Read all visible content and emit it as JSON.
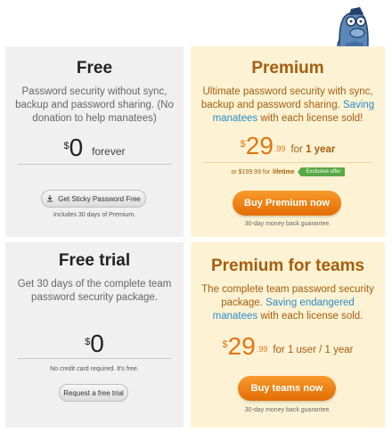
{
  "free": {
    "title": "Free",
    "description": "Password security without sync, backup and password sharing. (No donation to help manatees)",
    "currency": "$",
    "price": "0",
    "period": "forever",
    "button_label": "Get Sticky Password Free",
    "note": "Includes 30 days of Premium."
  },
  "premium": {
    "title": "Premium",
    "description_part1": "Ultimate password security with sync, backup and password sharing. ",
    "description_link": "Saving manatees",
    "description_part2": " with each license sold!",
    "currency": "$",
    "price": "29",
    "cents": ".99",
    "period_prefix": "for ",
    "period_bold": "1 year",
    "alt_price": "or $199.99 for",
    "alt_bold": "lifetime",
    "badge": "Exclusive offer",
    "button_label": "Buy Premium now",
    "note": "30-day money back guarantee."
  },
  "trial": {
    "title": "Free trial",
    "description": "Get 30 days of the complete team password security package.",
    "currency": "$",
    "price": "0",
    "note": "No credit card required. It's free.",
    "button_label": "Request a free trial"
  },
  "teams": {
    "title": "Premium for teams",
    "description_part1": "The complete team password security package. ",
    "description_link": "Saving endangered manatees",
    "description_part2": " with each license sold.",
    "currency": "$",
    "price": "29",
    "cents": ".99",
    "period": "for 1 user / 1 year",
    "button_label": "Buy teams now",
    "note": "30-day money back guarantee."
  },
  "mascot_icon": "manatee-mascot-icon",
  "download_icon": "download-icon",
  "colors": {
    "accent_orange": "#e36d05",
    "title_brown": "#a75d0e",
    "link_blue": "#2a8bc7",
    "badge_green": "#58a845",
    "premium_bg": "#fdf3d4",
    "free_bg": "#f0f0f0"
  }
}
